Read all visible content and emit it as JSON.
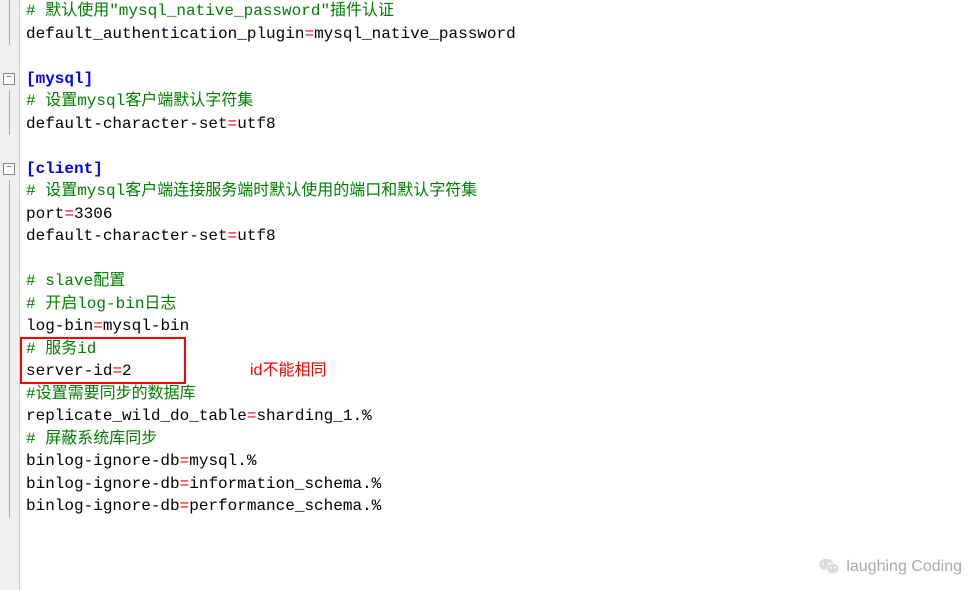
{
  "lines": [
    {
      "type": "comment",
      "text": "# 默认使用\"mysql_native_password\"插件认证"
    },
    {
      "type": "kv",
      "key": "default_authentication_plugin",
      "val": "mysql_native_password"
    },
    {
      "type": "blank",
      "text": ""
    },
    {
      "type": "section",
      "text": "[mysql]"
    },
    {
      "type": "comment",
      "text": "# 设置mysql客户端默认字符集"
    },
    {
      "type": "kv",
      "key": "default-character-set",
      "val": "utf8"
    },
    {
      "type": "blank",
      "text": ""
    },
    {
      "type": "section",
      "text": "[client]"
    },
    {
      "type": "comment",
      "text": "# 设置mysql客户端连接服务端时默认使用的端口和默认字符集"
    },
    {
      "type": "kv",
      "key": "port",
      "val": "3306"
    },
    {
      "type": "kv",
      "key": "default-character-set",
      "val": "utf8"
    },
    {
      "type": "blank",
      "text": ""
    },
    {
      "type": "comment",
      "text": "# slave配置"
    },
    {
      "type": "comment",
      "text": "# 开启log-bin日志"
    },
    {
      "type": "kv",
      "key": "log-bin",
      "val": "mysql-bin"
    },
    {
      "type": "comment",
      "text": "# 服务id"
    },
    {
      "type": "kv",
      "key": "server-id",
      "val": "2"
    },
    {
      "type": "comment",
      "text": "#设置需要同步的数据库"
    },
    {
      "type": "kv",
      "key": "replicate_wild_do_table",
      "val": "sharding_1.%"
    },
    {
      "type": "comment",
      "text": "# 屏蔽系统库同步"
    },
    {
      "type": "kv",
      "key": "binlog-ignore-db",
      "val": "mysql.%"
    },
    {
      "type": "kv",
      "key": "binlog-ignore-db",
      "val": "information_schema.%"
    },
    {
      "type": "kv",
      "key": "binlog-ignore-db",
      "val": "performance_schema.%"
    }
  ],
  "fold_markers": [
    {
      "line": 3,
      "symbol": "−"
    },
    {
      "line": 7,
      "symbol": "−"
    }
  ],
  "fold_vlines": [
    {
      "from": 0,
      "to": 2
    },
    {
      "from": 4,
      "to": 6
    },
    {
      "from": 8,
      "to": 23
    }
  ],
  "highlight": {
    "box": {
      "line_from": 15,
      "line_to": 16
    },
    "annotation_text": "id不能相同",
    "annotation_line": 16
  },
  "watermark": "laughing Coding"
}
